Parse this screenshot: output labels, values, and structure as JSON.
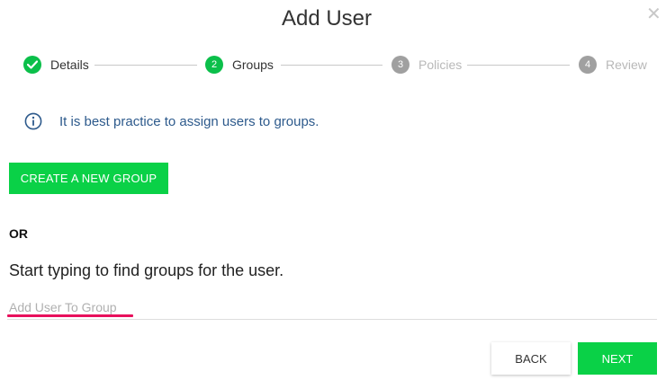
{
  "dialog": {
    "title": "Add User",
    "close_icon": "close-icon"
  },
  "steps": [
    {
      "label": "Details",
      "status": "done",
      "number": ""
    },
    {
      "label": "Groups",
      "status": "active",
      "number": "2"
    },
    {
      "label": "Policies",
      "status": "pending",
      "number": "3"
    },
    {
      "label": "Review",
      "status": "pending",
      "number": "4"
    }
  ],
  "info": {
    "icon": "info-icon",
    "text": "It is best practice to assign users to groups."
  },
  "create_group": {
    "label": "CREATE A NEW GROUP"
  },
  "or_label": "OR",
  "search": {
    "hint": "Start typing to find groups for the user.",
    "placeholder": "Add User To Group",
    "value": ""
  },
  "footer": {
    "back_label": "BACK",
    "next_label": "NEXT"
  },
  "colors": {
    "accent_green": "#0ad147",
    "step_done": "#0bbf4a",
    "step_pending": "#a0a0a0",
    "info_text": "#2d5a8c",
    "focus_underline": "#e8105c"
  }
}
